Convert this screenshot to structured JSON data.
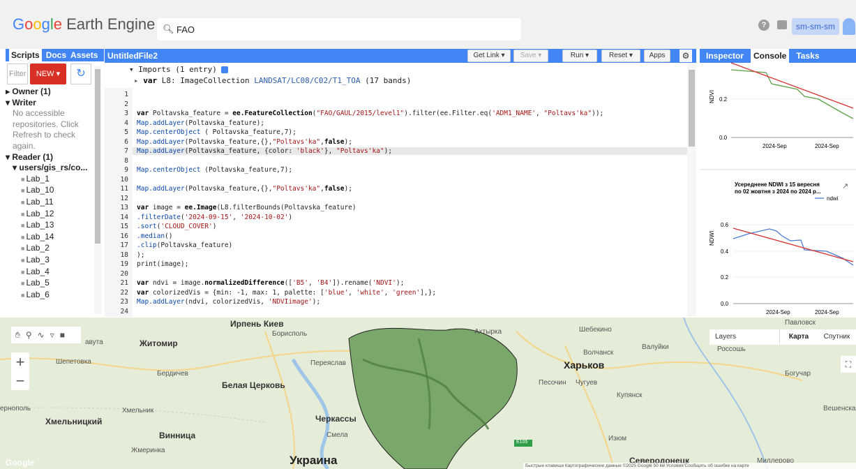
{
  "header": {
    "logo_google": "Google",
    "logo_rest": " Earth Engine",
    "search_value": "FAO",
    "account": "sm-sm-sm",
    "help": "?"
  },
  "left": {
    "tabs": [
      "Scripts",
      "Docs",
      "Assets"
    ],
    "filter_placeholder": "Filter",
    "new_label": "NEW ▾",
    "tree": [
      {
        "t": "▸ Owner (1)",
        "c": "b"
      },
      {
        "t": "▾ Writer",
        "c": "b"
      },
      {
        "t": "No accessible repositories. Click Refresh to check again.",
        "c": "gray"
      },
      {
        "t": "▾ Reader (1)",
        "c": "b"
      },
      {
        "t": "▾ users/gis_rs/co...",
        "c": "b ind"
      },
      {
        "t": "Lab_1",
        "c": "f"
      },
      {
        "t": "Lab_10",
        "c": "f"
      },
      {
        "t": "Lab_11",
        "c": "f"
      },
      {
        "t": "Lab_12",
        "c": "f"
      },
      {
        "t": "Lab_13",
        "c": "f"
      },
      {
        "t": "Lab_14",
        "c": "f"
      },
      {
        "t": "Lab_2",
        "c": "f"
      },
      {
        "t": "Lab_3",
        "c": "f"
      },
      {
        "t": "Lab_4",
        "c": "f"
      },
      {
        "t": "Lab_5",
        "c": "f"
      },
      {
        "t": "Lab_6",
        "c": "f"
      }
    ]
  },
  "editor": {
    "file": "UntitledFile2",
    "buttons": {
      "getlink": "Get Link",
      "save": "Save",
      "run": "Run",
      "reset": "Reset",
      "apps": "Apps"
    },
    "imports_header": "Imports (1 entry)",
    "imports_var": "L8",
    "imports_type": "ImageCollection",
    "imports_id": "LANDSAT/LC08/C02/T1_TOA",
    "imports_bands": "(17 bands)",
    "lines": [
      "",
      "",
      "var Poltavska_feature = ee.FeatureCollection(\"FAO/GAUL/2015/level1\").filter(ee.Filter.eq('ADM1_NAME', \"Poltavs'ka\"));",
      "Map.addLayer(Poltavska_feature);",
      "Map.centerObject ( Poltavska_feature,7);",
      "Map.addLayer(Poltavska_feature,{},\"Poltavs'ka\",false);",
      "Map.addLayer(Poltavska_feature, {color: 'black'}, \"Poltavs'ka\");",
      "",
      "Map.centerObject (Poltavska_feature,7);",
      "",
      "Map.addLayer(Poltavska_feature,{},\"Poltavs'ka\",false);",
      "",
      "var image = ee.Image(L8.filterBounds(Poltavska_feature)",
      ".filterDate('2024-09-15', '2024-10-02')",
      ".sort('CLOUD_COVER')",
      ".median()",
      ".clip(Poltavska_feature)",
      ");",
      "print(image);",
      "",
      "var ndvi = image.normalizedDifference(['B5', 'B4']).rename('NDVI');",
      "var colorizedVis = {min: -1, max: 1, palette: ['blue', 'white', 'green'],};",
      "Map.addLayer(ndvi, colorizedVis, 'NDVIimage');",
      ""
    ]
  },
  "right": {
    "tabs": [
      "Inspector",
      "Console",
      "Tasks"
    ],
    "chart1": {
      "ylabel": "NDVI",
      "yticks": [
        "0.2",
        "0.0"
      ],
      "xticks": [
        "2024-Sep",
        "2024-Sep"
      ]
    },
    "chart2": {
      "title": "Усереднене NDWI з 15 вересня по 02 жовтня з 2024 по 2024 р...",
      "legend": "ndwi",
      "ylabel": "NDWI",
      "yticks": [
        "0.6",
        "0.4",
        "0.2",
        "0.0"
      ],
      "xticks": [
        "2024-Sep",
        "2024-Sep"
      ]
    }
  },
  "map": {
    "layers": "Layers",
    "karta": "Карта",
    "sputnik": "Спутник",
    "labels": {
      "kiev": "Ирпень Киев",
      "borispol": "Борисполь",
      "zhitomir": "Житомир",
      "avuta": "авута",
      "shepetovka": "Шепетовка",
      "berdichev": "Бердичев",
      "belaya": "Белая Церковь",
      "pereyaslav": "Переяслав",
      "ternopol": "ернополь",
      "khmelnik": "Хмельник",
      "khmelnitsky": "Хмельницкий",
      "cherkassy": "Черкассы",
      "vinnitsa": "Винница",
      "smela": "Смела",
      "zhmerinka": "Жмеринка",
      "ukraine": "Украина",
      "akhtyrka": "Ахтырка",
      "shebekino": "Шебекино",
      "volchansk": "Волчанск",
      "valuyki": "Валуйки",
      "kharkov": "Харьков",
      "pesochin": "Песочин",
      "chuguev": "Чугуев",
      "kupyansk": "Купянск",
      "izyum": "Изюм",
      "severodonetsk": "Северодонецк",
      "rossosh": "Россошь",
      "boguchar": "Богучар",
      "veshenskaya": "Вешенская",
      "pavlovsk": "Павловск",
      "millerovo": "Миллерово",
      "e105": "E105"
    },
    "attribution": "Быстрые клавиши  Картографические данные ©2025 Google   50 км      Условия   Сообщить об ошибке на карте",
    "google": "Google"
  },
  "colors": {
    "accent": "#4285f4",
    "new": "#d93025"
  }
}
